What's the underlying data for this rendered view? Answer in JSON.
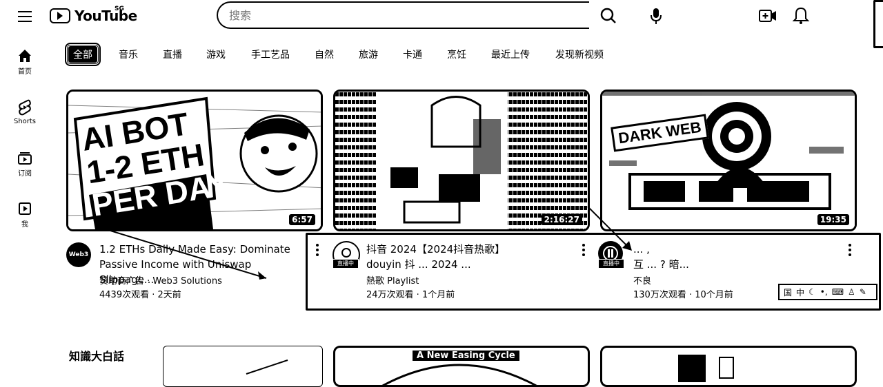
{
  "header": {
    "logo_text": "YouTube",
    "country_code": "SG",
    "search_placeholder": "搜索"
  },
  "left_nav": [
    {
      "label": "首页",
      "icon": "home-icon"
    },
    {
      "label": "Shorts",
      "icon": "shorts-icon"
    },
    {
      "label": "订阅",
      "icon": "subscriptions-icon"
    },
    {
      "label": "我",
      "icon": "you-icon"
    }
  ],
  "chips": [
    "全部",
    "音乐",
    "直播",
    "游戏",
    "手工艺品",
    "自然",
    "旅游",
    "卡通",
    "烹饪",
    "最近上传",
    "发现新视频"
  ],
  "videos": [
    {
      "thumb_text": [
        "AI BOT",
        "1-2 ETH",
        "PER DAY"
      ],
      "duration": "6:57",
      "avatar_text": "Web3",
      "title_line1": "1.2 ETHs Daily Made Easy: Dominate",
      "title_line2": "Passive Income with Uniswap Slippage...",
      "channel": "赞助商广告 · Web3 Solutions",
      "stats": "4439次观看 · 2天前"
    },
    {
      "duration": "2:16:27",
      "live_label": "直播中",
      "title_line1": "抖音 2024【2024抖音热歌】",
      "title_line2": "douyin 抖 ... 2024 ...",
      "channel": "熱歌 Playlist",
      "stats": "24万次观看 · 1个月前"
    },
    {
      "thumb_text": [
        "DARK WEB"
      ],
      "duration": "19:35",
      "live_label": "直播中",
      "title_line1": "... ,",
      "title_line2": "互 ... ? 暗...",
      "channel": "不良",
      "stats": "130万次观看 · 10个月前"
    }
  ],
  "second_row": {
    "avatar_text": "知識大白話",
    "banner_text": "A New Easing Cycle"
  },
  "mini_toolbar": [
    "国",
    "中"
  ]
}
